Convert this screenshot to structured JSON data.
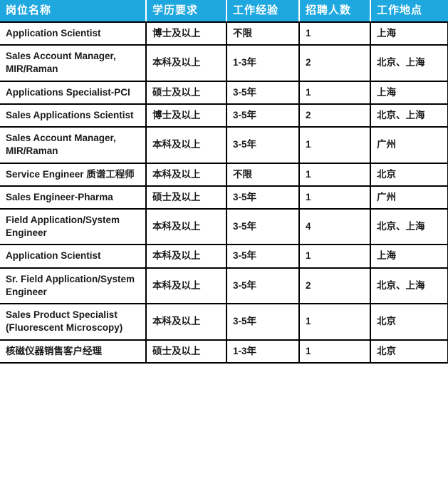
{
  "table": {
    "columns": [
      {
        "key": "title",
        "label": "岗位名称"
      },
      {
        "key": "education",
        "label": "学历要求"
      },
      {
        "key": "experience",
        "label": "工作经验"
      },
      {
        "key": "headcount",
        "label": "招聘人数"
      },
      {
        "key": "location",
        "label": "工作地点"
      }
    ],
    "header_bg": "#1FA8E0",
    "header_text_color": "#FFFFFF",
    "border_color": "#000000",
    "rows": [
      {
        "title": "Application Scientist",
        "education": "博士及以上",
        "experience": "不限",
        "headcount": "1",
        "location": "上海"
      },
      {
        "title": "Sales Account Manager, MIR/Raman",
        "education": "本科及以上",
        "experience": "1-3年",
        "headcount": "2",
        "location": "北京、上海"
      },
      {
        "title": "Applications Specialist-PCI",
        "education": "硕士及以上",
        "experience": "3-5年",
        "headcount": "1",
        "location": "上海"
      },
      {
        "title": "Sales Applications Scientist",
        "education": "博士及以上",
        "experience": "3-5年",
        "headcount": "2",
        "location": "北京、上海"
      },
      {
        "title": "Sales Account Manager, MIR/Raman",
        "education": "本科及以上",
        "experience": "3-5年",
        "headcount": "1",
        "location": "广州"
      },
      {
        "title": "Service Engineer 质谱工程师",
        "education": "本科及以上",
        "experience": "不限",
        "headcount": "1",
        "location": "北京"
      },
      {
        "title": "Sales Engineer-Pharma",
        "education": "硕士及以上",
        "experience": "3-5年",
        "headcount": "1",
        "location": "广州"
      },
      {
        "title": "Field Application/System Engineer",
        "education": "本科及以上",
        "experience": "3-5年",
        "headcount": "4",
        "location": "北京、上海"
      },
      {
        "title": "Application Scientist",
        "education": "本科及以上",
        "experience": "3-5年",
        "headcount": "1",
        "location": "上海"
      },
      {
        "title": "Sr. Field Application/System Engineer",
        "education": "本科及以上",
        "experience": "3-5年",
        "headcount": "2",
        "location": "北京、上海"
      },
      {
        "title": "Sales Product Specialist (Fluorescent Microscopy)",
        "education": "本科及以上",
        "experience": "3-5年",
        "headcount": "1",
        "location": "北京"
      },
      {
        "title": "核磁仪器销售客户经理",
        "education": "硕士及以上",
        "experience": "1-3年",
        "headcount": "1",
        "location": "北京"
      }
    ]
  }
}
